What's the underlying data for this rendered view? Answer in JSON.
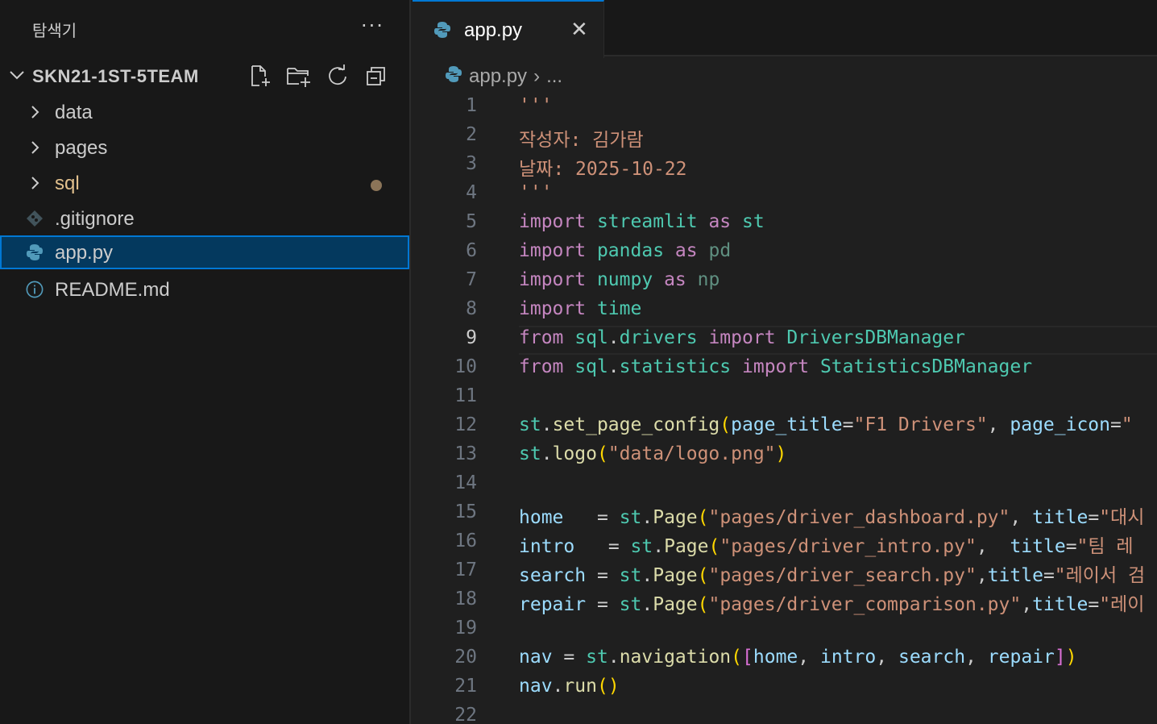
{
  "explorer": {
    "title": "탐색기",
    "more": "···",
    "project": "SKN21-1ST-5TEAM",
    "items": [
      {
        "label": "data",
        "type": "folder"
      },
      {
        "label": "pages",
        "type": "folder"
      },
      {
        "label": "sql",
        "type": "folder",
        "modified": true
      },
      {
        "label": ".gitignore",
        "type": "git"
      },
      {
        "label": "app.py",
        "type": "python",
        "selected": true
      },
      {
        "label": "README.md",
        "type": "info"
      }
    ]
  },
  "tab": {
    "label": "app.py",
    "close": "✕"
  },
  "breadcrumb": {
    "file": "app.py",
    "sep": "›",
    "more": "..."
  },
  "line_numbers": [
    "1",
    "2",
    "3",
    "4",
    "5",
    "6",
    "7",
    "8",
    "9",
    "10",
    "11",
    "12",
    "13",
    "14",
    "15",
    "16",
    "17",
    "18",
    "19",
    "20",
    "21",
    "22"
  ],
  "code": [
    "'''",
    "작성자: 김가람",
    "날짜: 2025-10-22",
    "'''",
    "import streamlit as st",
    "import pandas as pd",
    "import numpy as np",
    "import time",
    "from sql.drivers import DriversDBManager",
    "from sql.statistics import StatisticsDBManager",
    "",
    "st.set_page_config(page_title=\"F1 Drivers\", page_icon=\"",
    "st.logo(\"data/logo.png\")",
    "",
    "home   = st.Page(\"pages/driver_dashboard.py\", title=\"대시",
    "intro   = st.Page(\"pages/driver_intro.py\",  title=\"팀 레",
    "search = st.Page(\"pages/driver_search.py\",title=\"레이서 검",
    "repair = st.Page(\"pages/driver_comparison.py\",title=\"레이",
    "",
    "nav = st.navigation([home, intro, search, repair])",
    "nav.run()",
    ""
  ],
  "colors": {
    "accent": "#0078d4",
    "selection": "#04395e",
    "modified": "#e2c08d"
  }
}
